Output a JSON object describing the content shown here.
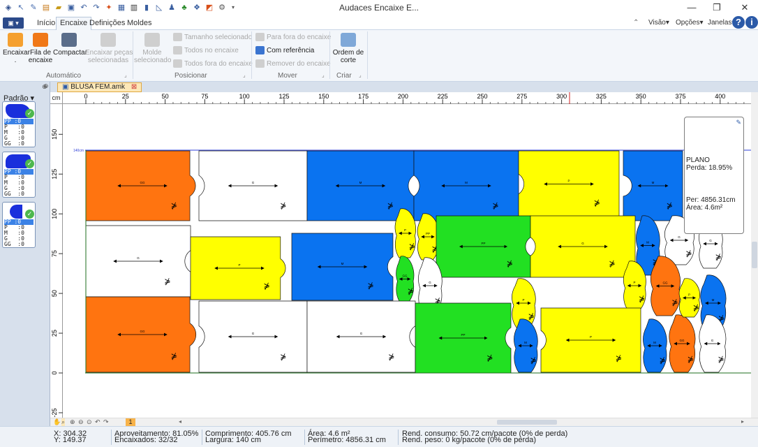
{
  "window": {
    "title": "Audaces Encaixe E...",
    "buttons": [
      "—",
      "❐",
      "✕"
    ]
  },
  "menu": {
    "app_button": "▣ ▾",
    "tabs": [
      "Início",
      "Encaixe",
      "Definições",
      "Moldes"
    ],
    "active_tab": "Encaixe",
    "right_items": [
      "Visão",
      "Opções",
      "Janelas"
    ]
  },
  "ribbon": {
    "encaixar": "Encaixar\n.",
    "fila": "Fila de\nencaixe",
    "compactar": "Compactar",
    "encaixar_pecas": "Encaixar peças\nselecionadas",
    "molde_selecionado": "Molde\nselecionado",
    "tamanho_selecionado": "Tamanho selecionado",
    "todos_no_encaixe": "Todos no encaixe",
    "todos_fora": "Todos fora do encaixe",
    "para_fora": "Para fora do encaixe",
    "com_referencia": "Com referência",
    "remover": "Remover do encaixe",
    "ordem_corte": "Ordem de\ncorte",
    "groups": [
      "Automático",
      "Posicionar",
      "Mover",
      "Criar"
    ]
  },
  "left_panel": {
    "header": "Padrão",
    "thumbs": [
      {
        "sizes": [
          "PP",
          "P",
          "M",
          "G",
          "GG"
        ],
        "values": [
          "0",
          "0",
          "0",
          "0",
          "0"
        ]
      },
      {
        "sizes": [
          "PP",
          "P",
          "M",
          "G",
          "GG"
        ],
        "values": [
          "0",
          "0",
          "0",
          "0",
          "0"
        ]
      },
      {
        "sizes": [
          "PP",
          "P",
          "M",
          "G",
          "GG"
        ],
        "values": [
          "0",
          "0",
          "0",
          "0",
          "0"
        ]
      }
    ]
  },
  "doc_tab": "BLUSA FEM.amk",
  "rulers": {
    "unit": "cm",
    "h_ticks": [
      "0",
      "25",
      "50",
      "75",
      "100",
      "125",
      "150",
      "175",
      "200",
      "225",
      "250",
      "275",
      "300",
      "325",
      "350",
      "375",
      "400"
    ],
    "v_ticks": [
      "150",
      "125",
      "100",
      "75",
      "50",
      "25",
      "0",
      "-25"
    ],
    "marker_label": "140cm"
  },
  "info_card": {
    "plano": "PLANO",
    "perda": "Perda: 18.95%",
    "per": "Per: 4856.31cm",
    "area": "Área: 4.6m²"
  },
  "statusbar": {
    "x": "X: 304.32",
    "y": "Y: 149.37",
    "aproveitamento": "Aproveitamento: 81.05%",
    "encaixados": "Encaixados: 32/32",
    "comprimento": "Comprimento: 405.76 cm",
    "largura": "Largura: 140 cm",
    "area": "Área: 4.6 m²",
    "perimetro": "Perímetro: 4856.31 cm",
    "rend_consumo": "Rend. consumo: 50.72 cm/pacote (0% de perda)",
    "rend_peso": "Rend. peso: 0 kg/pacote (0% de perda)",
    "page": "1"
  },
  "colors": {
    "orange": "#ff7410",
    "blue": "#0a73f0",
    "yellow": "#ffff00",
    "green": "#22e022",
    "white": "#ffffff",
    "marker_line": "#1c6e1c",
    "limit_line": "#2f3fd8"
  },
  "pieces": [
    {
      "label": "GG",
      "color": "orange"
    },
    {
      "label": "G",
      "color": "white"
    },
    {
      "label": "M",
      "color": "blue"
    },
    {
      "label": "M",
      "color": "blue"
    },
    {
      "label": "P",
      "color": "yellow"
    },
    {
      "label": "M",
      "color": "blue"
    },
    {
      "label": "G",
      "color": "white"
    },
    {
      "label": "P",
      "color": "yellow"
    },
    {
      "label": "M",
      "color": "blue"
    },
    {
      "label": "P",
      "color": "yellow"
    },
    {
      "label": "PP",
      "color": "yellow"
    },
    {
      "label": "PP",
      "color": "green"
    },
    {
      "label": "G",
      "color": "yellow"
    },
    {
      "label": "M",
      "color": "blue"
    },
    {
      "label": "G",
      "color": "white"
    },
    {
      "label": "G",
      "color": "white"
    },
    {
      "label": "GG",
      "color": "green"
    },
    {
      "label": "G",
      "color": "white"
    },
    {
      "label": "P",
      "color": "yellow"
    },
    {
      "label": "GG",
      "color": "orange"
    },
    {
      "label": "P",
      "color": "yellow"
    },
    {
      "label": "M",
      "color": "blue"
    },
    {
      "label": "GG",
      "color": "orange"
    },
    {
      "label": "G",
      "color": "white"
    },
    {
      "label": "G",
      "color": "white"
    },
    {
      "label": "PP",
      "color": "green"
    },
    {
      "label": "M",
      "color": "blue"
    },
    {
      "label": "P",
      "color": "yellow"
    },
    {
      "label": "M",
      "color": "blue"
    },
    {
      "label": "GG",
      "color": "orange"
    },
    {
      "label": "G",
      "color": "white"
    },
    {
      "label": "P",
      "color": "yellow"
    }
  ]
}
